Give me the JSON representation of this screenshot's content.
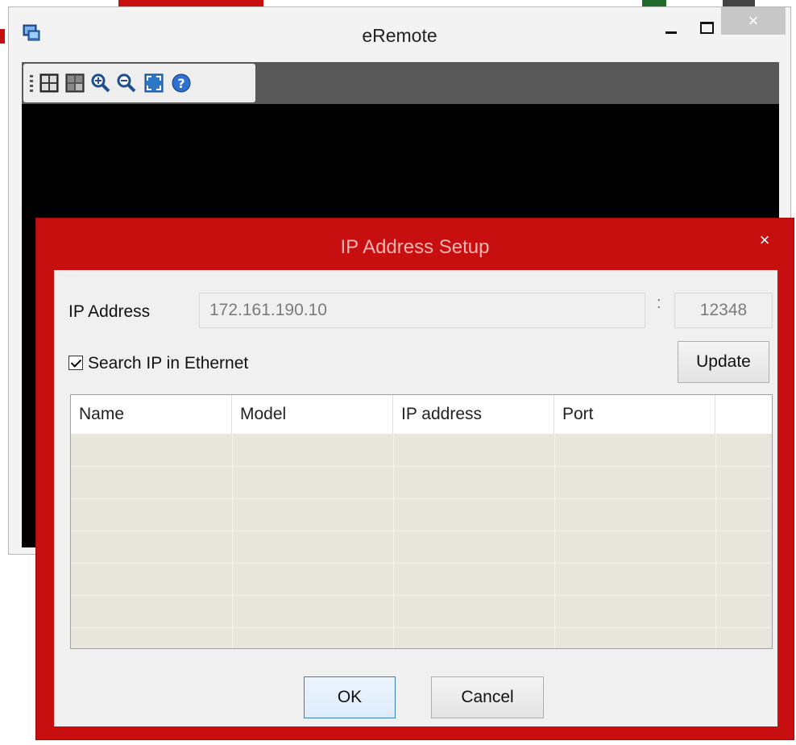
{
  "main_window": {
    "title": "eRemote",
    "close_glyph": "×",
    "toolbar": {
      "buttons": [
        {
          "name": "layout-1-icon"
        },
        {
          "name": "layout-2-icon"
        },
        {
          "name": "zoom-in-icon"
        },
        {
          "name": "zoom-out-icon"
        },
        {
          "name": "fullscreen-icon"
        },
        {
          "name": "help-icon"
        }
      ]
    }
  },
  "dialog": {
    "title": "IP Address Setup",
    "close_glyph": "×",
    "ip_label": "IP Address",
    "ip_value": "172.161.190.10",
    "colon": ":",
    "port_value": "12348",
    "search_label": "Search IP in Ethernet",
    "search_checked": true,
    "update_label": "Update",
    "table": {
      "columns": [
        "Name",
        "Model",
        "IP address",
        "Port"
      ],
      "rows": []
    },
    "ok_label": "OK",
    "cancel_label": "Cancel"
  }
}
